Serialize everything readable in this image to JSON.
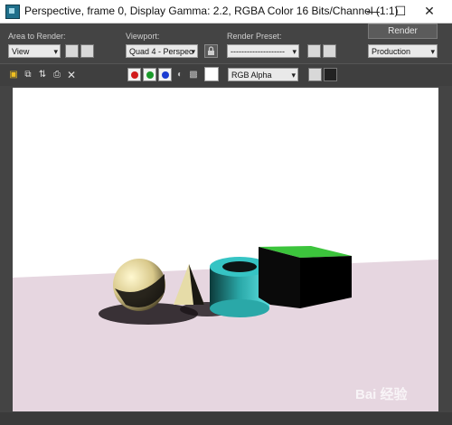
{
  "window": {
    "title": "Perspective, frame 0, Display Gamma: 2.2, RGBA Color 16 Bits/Channel (1:1)",
    "minimize_glyph": "—",
    "maximize_glyph": "☐",
    "close_glyph": "✕"
  },
  "controls": {
    "area_label": "Area to Render:",
    "area_value": "View",
    "viewport_label": "Viewport:",
    "viewport_value": "Quad 4 - Perspec",
    "preset_label": "Render Preset:",
    "preset_value": "--------------------",
    "render_button": "Render",
    "production_value": "Production"
  },
  "toolbar": {
    "channel_display": "RGB Alpha",
    "icons": [
      "save-image-icon",
      "clone-window-icon",
      "copy-image-icon",
      "print-icon",
      "clear-icon",
      "red-channel-icon",
      "green-channel-icon",
      "blue-channel-icon",
      "alpha-channel-icon",
      "mono-icon",
      "color-swatch-icon",
      "display-toggle-icon",
      "frame-buffer-icon"
    ]
  },
  "colors": {
    "red_channel": "#d11a1a",
    "green_channel": "#1a9a2a",
    "blue_channel": "#1a3bd1",
    "floor": "#e6d6e0",
    "box_top": "#3cc43c",
    "torus": "#38c0c0"
  },
  "watermark": "Bai 经验"
}
